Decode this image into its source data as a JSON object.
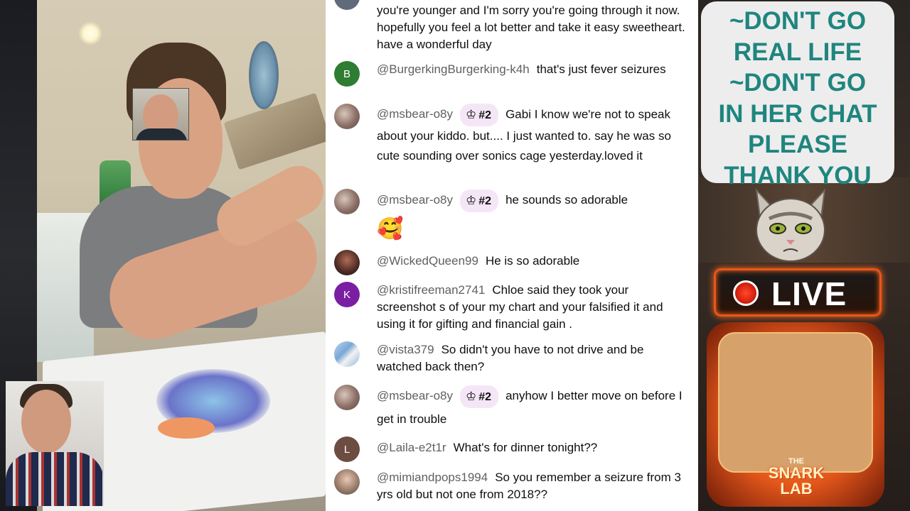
{
  "chat": {
    "top_partial": "you're younger and I'm sorry you're going through it now. hopefully you feel a lot better and take it easy sweetheart. have a wonderful day",
    "messages": [
      {
        "avatar_letter": "B",
        "avatar_color": "#2e7d32",
        "author": "@BurgerkingBurgerking-k4h",
        "text": "that's just fever seizures"
      },
      {
        "author": "@msbear-o8y",
        "badge": "#2",
        "text": "Gabi I know we're not to speak about your kiddo. but.... I just wanted to. say he was so cute sounding over sonics cage yesterday.loved it"
      },
      {
        "author": "@msbear-o8y",
        "badge": "#2",
        "text": "he sounds so adorable",
        "emoji": "🥰"
      },
      {
        "author": "@WickedQueen99",
        "text": "He is so adorable"
      },
      {
        "avatar_letter": "K",
        "avatar_color": "#7b1fa2",
        "author": "@kristifreeman2741",
        "text": "Chloe said they took your screenshot s of your my chart and your falsified it and using it for gifting and financial gain ."
      },
      {
        "author": "@vista379",
        "text": "So didn't you have to not drive and be watched back then?"
      },
      {
        "author": "@msbear-o8y",
        "badge": "#2",
        "text": "anyhow I better move on before I get in trouble"
      },
      {
        "avatar_letter": "L",
        "avatar_color": "#6d4c41",
        "author": "@Laila-e2t1r",
        "text": "What's for dinner tonight??"
      },
      {
        "author": "@mimiandpops1994",
        "text": "So you remember a seizure from 3 yrs old but not one from 2018??"
      }
    ]
  },
  "overlay": {
    "notice_lines": [
      "~DON'T GO",
      "REAL LIFE",
      "~DON'T GO",
      "IN HER CHAT",
      "PLEASE",
      "THANK YOU"
    ],
    "notice_color": "#1f857f",
    "live_label": "LIVE",
    "logo_the": "THE",
    "logo_snark": "SNARK",
    "logo_lab": "LAB"
  }
}
